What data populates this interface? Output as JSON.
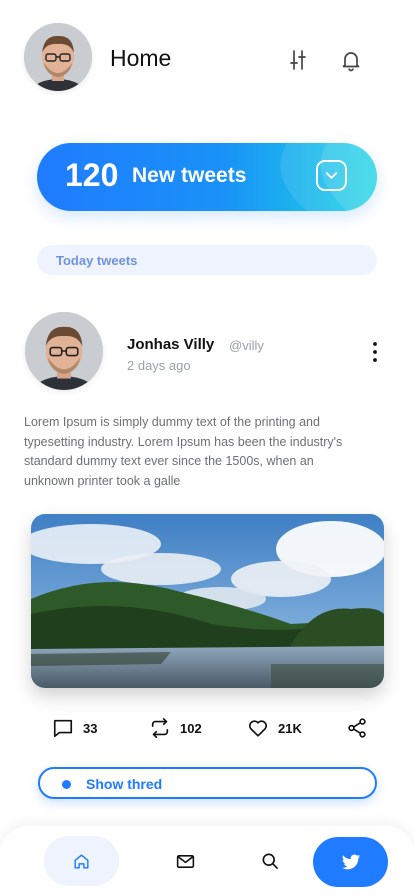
{
  "colors": {
    "accent": "#1f7bff",
    "accent_light": "#eef3fd",
    "text_muted": "#9aa0a6"
  },
  "header": {
    "title": "Home",
    "icons": [
      "avatar",
      "sliders-icon",
      "bell-icon"
    ]
  },
  "banner": {
    "count": "120",
    "label": "New tweets",
    "icon": "chevron-down-icon"
  },
  "section": {
    "label": "Today tweets"
  },
  "tweet": {
    "author_name": "Jonhas Villy",
    "handle": "@villy",
    "time_ago": "2 days ago",
    "text": "Lorem Ipsum is simply dummy text of the printing and typesetting industry. Lorem Ipsum has been the industry's standard dummy text ever since the 1500s, when an unknown printer took a galle",
    "actions": {
      "comments": "33",
      "retweets": "102",
      "likes": "21K"
    }
  },
  "thread_button": {
    "label": "Show thred"
  },
  "bottom_nav": {
    "items": [
      "home-icon",
      "mail-icon",
      "search-icon",
      "twitter-bird-icon"
    ]
  }
}
